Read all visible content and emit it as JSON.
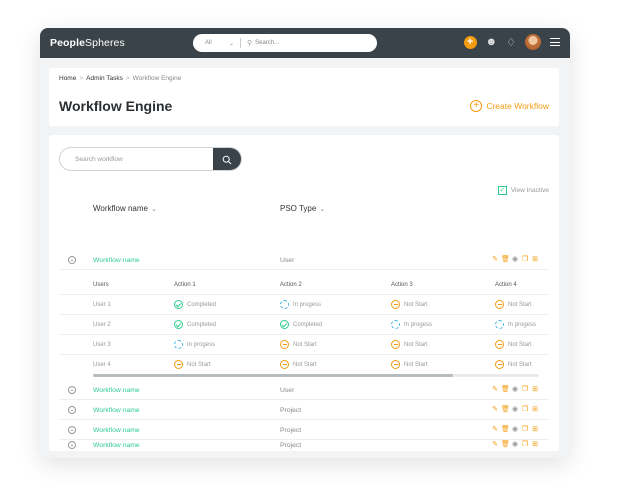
{
  "topbar": {
    "logo_bold": "People",
    "logo_thin": "Spheres",
    "search_scope": "All",
    "search_placeholder": "Search..."
  },
  "breadcrumb": {
    "home": "Home",
    "admin": "Admin Tasks",
    "current": "Workflow Engine",
    "separator": ">"
  },
  "page": {
    "title": "Workflow Engine",
    "create_label": "Create Workflow"
  },
  "search": {
    "placeholder": "Search workflow"
  },
  "filters": {
    "view_inactive": "View Inactive",
    "view_inactive_checked": true
  },
  "table": {
    "col_name": "Workflow name",
    "col_type": "PSO Type",
    "rows": [
      {
        "name": "Workflow name",
        "type": "User"
      },
      {
        "name": "Workflow name",
        "type": "User"
      },
      {
        "name": "Workflow name",
        "type": "Project"
      },
      {
        "name": "Workflow name",
        "type": "Project"
      },
      {
        "name": "Workflow name",
        "type": "Project"
      }
    ]
  },
  "subtable": {
    "headers": [
      "Users",
      "Action 1",
      "Action 2",
      "Action 3",
      "Action 4"
    ],
    "rows": [
      {
        "user": "User 1",
        "a1": "Completed",
        "a2": "In progess",
        "a3": "Not Start",
        "a4": "Not Start",
        "s1": "completed",
        "s2": "progress",
        "s3": "notstart",
        "s4": "notstart"
      },
      {
        "user": "User 2",
        "a1": "Completed",
        "a2": "Completed",
        "a3": "In progess",
        "a4": "In progess",
        "s1": "completed",
        "s2": "completed",
        "s3": "progress",
        "s4": "progress"
      },
      {
        "user": "User 3",
        "a1": "In progess",
        "a2": "Not Start",
        "a3": "Not Start",
        "a4": "Not Start",
        "s1": "progress",
        "s2": "notstart",
        "s3": "notstart",
        "s4": "notstart"
      },
      {
        "user": "User 4",
        "a1": "Not Start",
        "a2": "Not Start",
        "a3": "Not Start",
        "a4": "Not Start",
        "s1": "notstart",
        "s2": "notstart",
        "s3": "notstart",
        "s4": "notstart"
      }
    ]
  },
  "colors": {
    "accent": "#f39c12",
    "green": "#2ecc8f",
    "blue": "#3bb3e0",
    "topbar": "#3a4349"
  },
  "icons": {
    "row_actions": [
      "pencil-icon",
      "trash-icon",
      "eye-icon",
      "copy-icon",
      "export-icon"
    ]
  }
}
